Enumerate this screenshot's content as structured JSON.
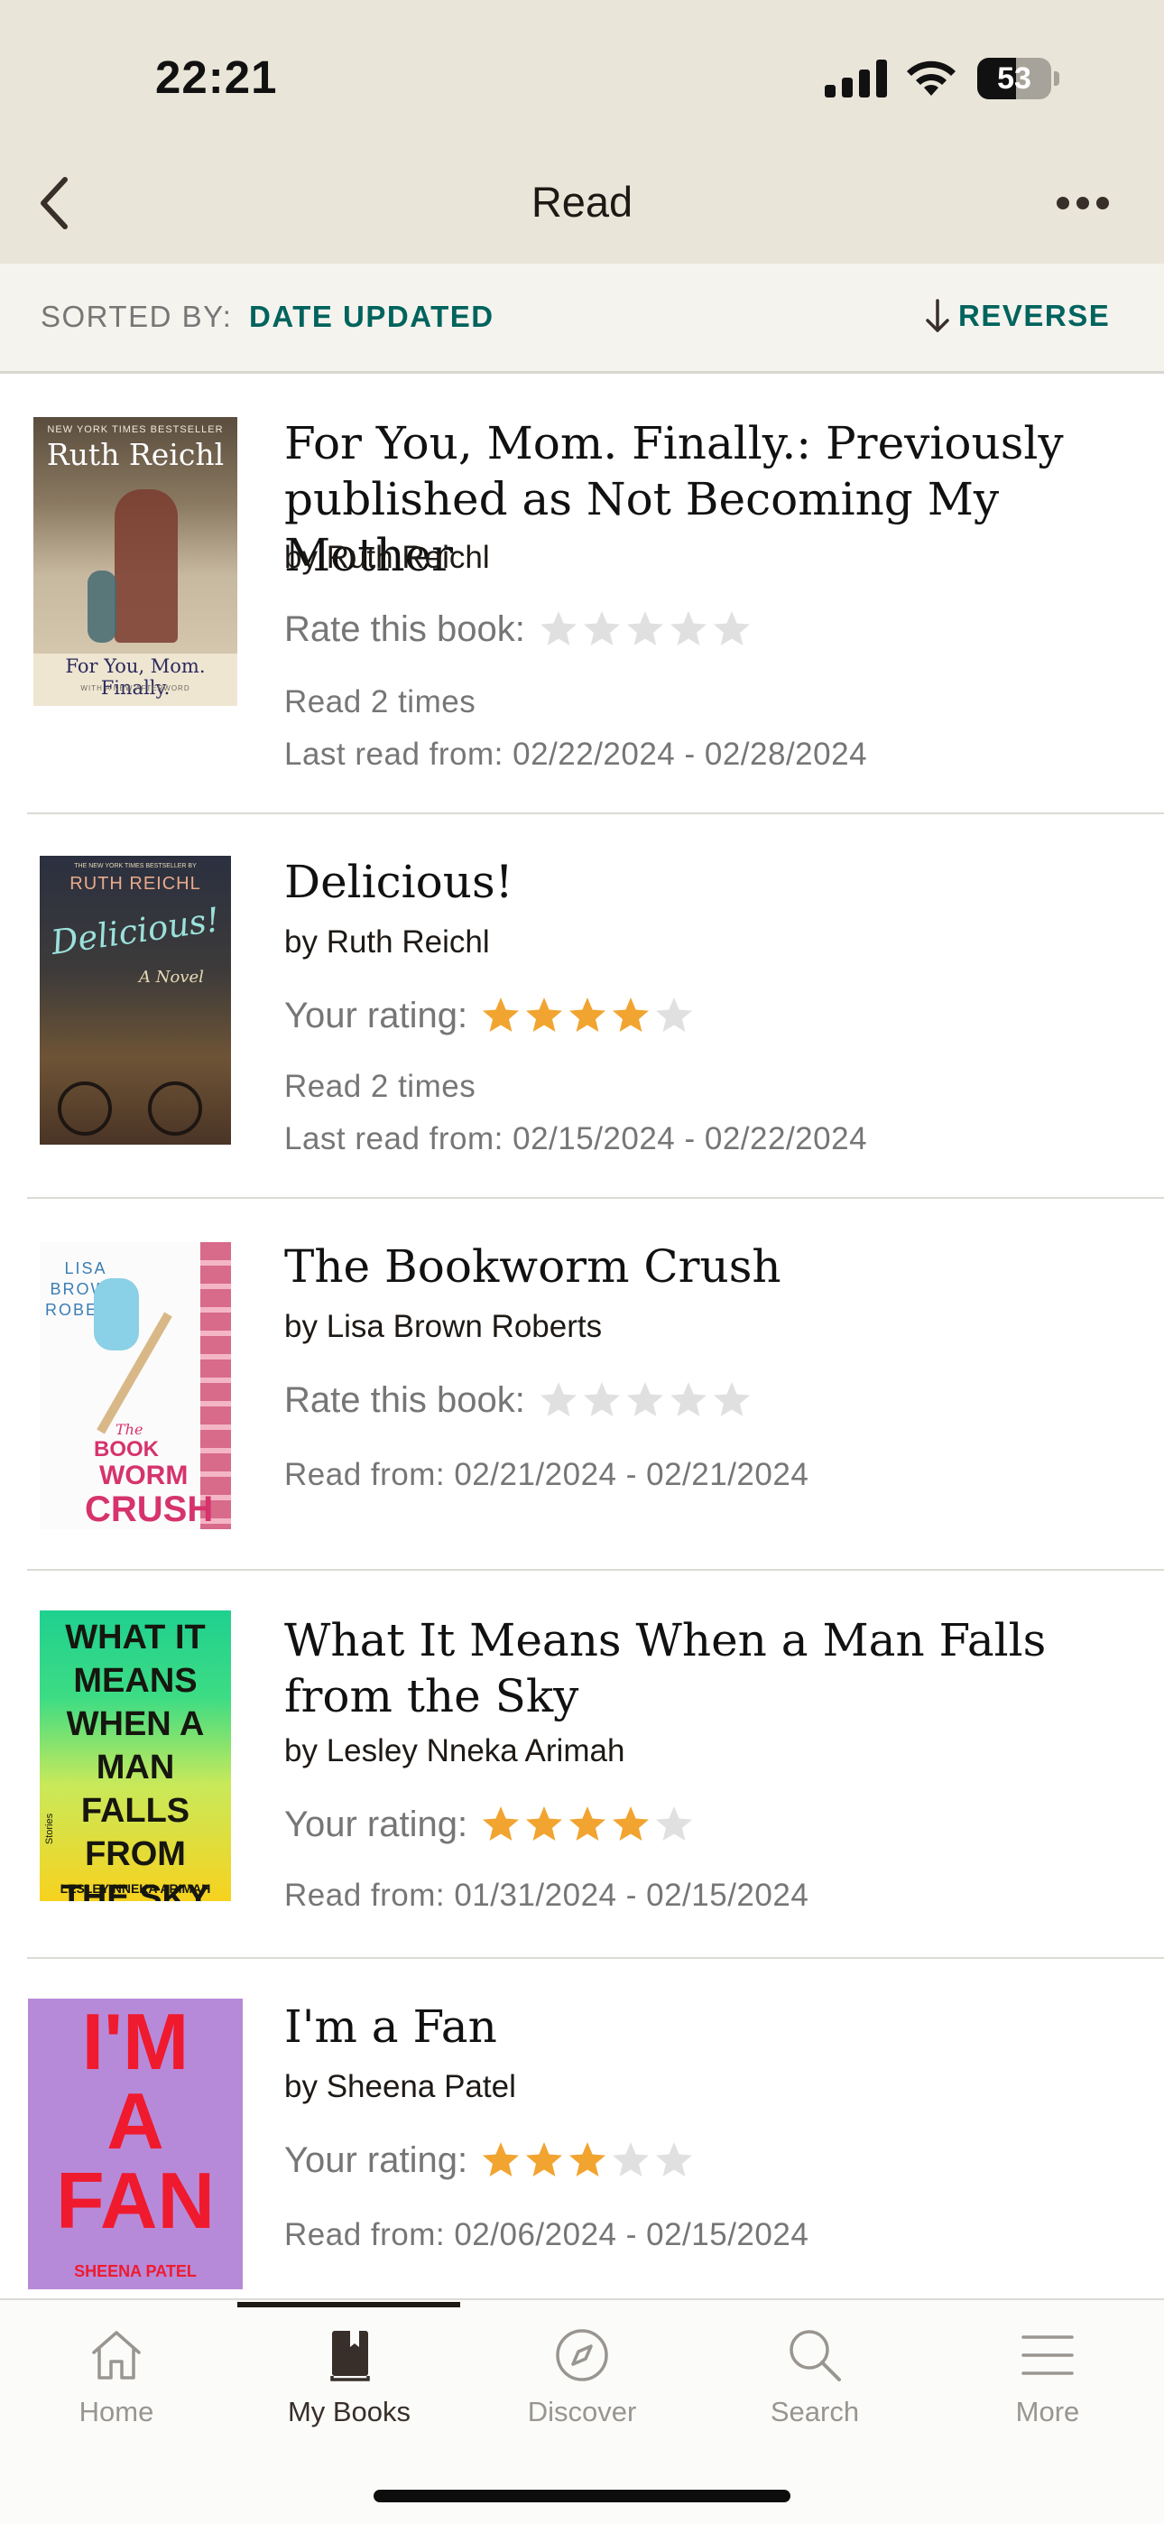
{
  "status_bar": {
    "time": "22:21",
    "battery": "53",
    "battery_level": 0.53
  },
  "nav": {
    "title": "Read",
    "back_icon": "chevron-left-icon",
    "more_icon": "ellipsis-icon"
  },
  "sort": {
    "label": "SORTED BY:",
    "value": "DATE UPDATED",
    "reverse_label": "REVERSE"
  },
  "books": [
    {
      "title": "For You, Mom. Finally.: Previously published as Not Becoming My Mother",
      "author": "by Ruth Reichl",
      "rating_label": "Rate this book:",
      "rating": 0,
      "meta1": "Read 2 times",
      "meta2": "Last read from: 02/22/2024 - 02/28/2024",
      "cover": {
        "top": "NEW YORK TIMES BESTSELLER",
        "author": "Ruth Reichl",
        "title": "For You, Mom. Finally.",
        "bottom": "WITH A NEW AFTERWORD"
      }
    },
    {
      "title": "Delicious!",
      "author": "by Ruth Reichl",
      "rating_label": "Your rating:",
      "rating": 4,
      "meta1": "Read 2 times",
      "meta2": "Last read from: 02/15/2024 - 02/22/2024",
      "cover": {
        "top": "THE NEW YORK TIMES BESTSELLER BY",
        "author": "RUTH REICHL",
        "title": "Delicious!",
        "sub": "A Novel"
      }
    },
    {
      "title": "The Bookworm Crush",
      "author": "by Lisa Brown Roberts",
      "rating_label": "Rate this book:",
      "rating": 0,
      "meta1": "Read from: 02/21/2024 - 02/21/2024",
      "cover": {
        "author": "LISA BROWN ROBERTS",
        "the": "The",
        "title1": "BOOK",
        "title2": "WORM",
        "title3": "CRUSH"
      }
    },
    {
      "title": "What It Means When a Man Falls from the Sky",
      "author": "by Lesley Nneka Arimah",
      "rating_label": "Your rating:",
      "rating": 4,
      "meta1": "Read from: 01/31/2024 - 02/15/2024",
      "cover": {
        "title": [
          "WHAT IT",
          "MEANS",
          "WHEN A",
          "MAN FALLS",
          "FROM",
          "THE SKY"
        ],
        "side": "Stories",
        "author": "LESLEY NNEKA ARIMAH"
      }
    },
    {
      "title": "I'm a Fan",
      "author": "by Sheena Patel",
      "rating_label": "Your rating:",
      "rating": 3,
      "meta1": "Read from: 02/06/2024 - 02/15/2024",
      "cover": {
        "title": [
          "I'M",
          "A",
          "FAN"
        ],
        "author": "SHEENA PATEL"
      }
    }
  ],
  "tabs": [
    {
      "label": "Home",
      "icon": "home-icon"
    },
    {
      "label": "My Books",
      "icon": "book-icon",
      "active": true
    },
    {
      "label": "Discover",
      "icon": "compass-icon"
    },
    {
      "label": "Search",
      "icon": "search-icon"
    },
    {
      "label": "More",
      "icon": "menu-icon"
    }
  ],
  "colors": {
    "header_bg": "#e9e5d8",
    "accent": "#00635d",
    "star_filled": "#f1a430",
    "star_empty": "#e0e0e0"
  }
}
